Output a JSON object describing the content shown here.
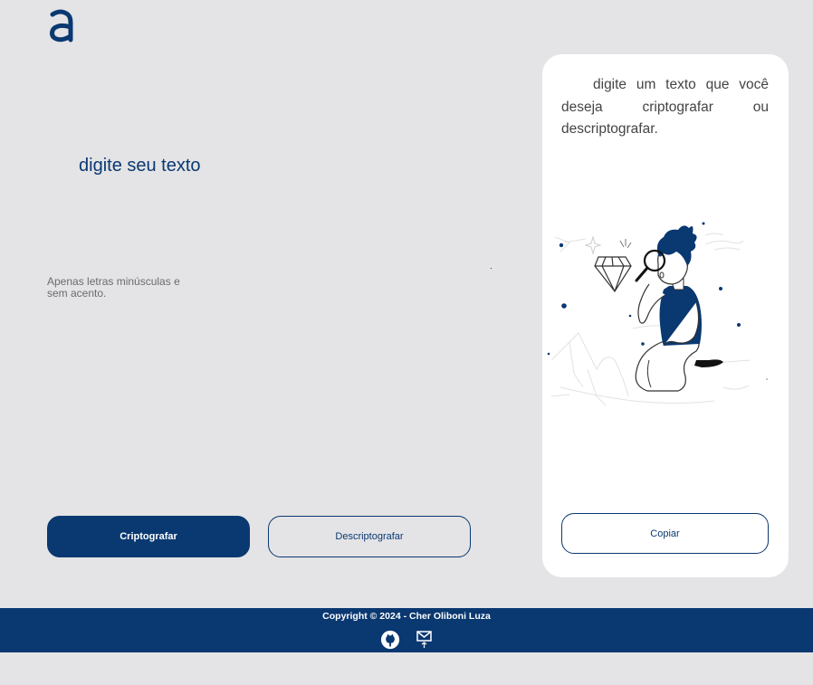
{
  "input": {
    "placeholder": "digite seu texto"
  },
  "hint": {
    "text": "Apenas letras minúsculas e sem acento."
  },
  "buttons": {
    "encrypt": "Criptografar",
    "decrypt": "Descriptografar",
    "copy": "Copiar"
  },
  "output": {
    "message": "digite um texto que você deseja criptografar ou descriptografar."
  },
  "footer": {
    "copyright": "Copyright © 2024 - Cher Oliboni Luza"
  },
  "icons": {
    "logo": "alura-logo-icon",
    "github": "github-icon",
    "email": "email-icon"
  },
  "colors": {
    "primary": "#0a3871",
    "background": "#e4e4e6",
    "panel": "#ffffff"
  }
}
